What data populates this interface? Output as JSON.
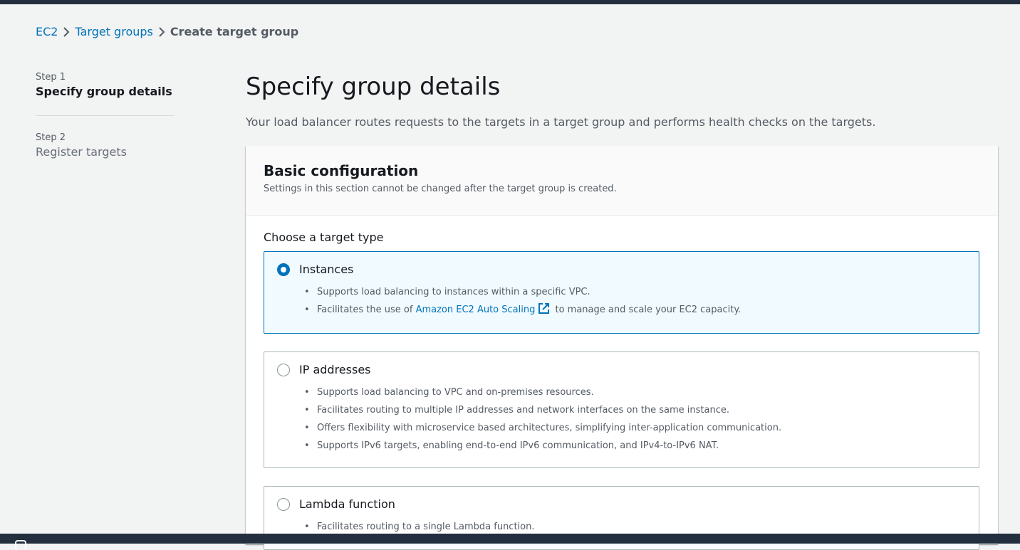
{
  "breadcrumb": {
    "items": [
      "EC2",
      "Target groups"
    ],
    "current": "Create target group"
  },
  "steps": [
    {
      "num": "Step 1",
      "title": "Specify group details"
    },
    {
      "num": "Step 2",
      "title": "Register targets"
    }
  ],
  "page": {
    "title": "Specify group details",
    "description": "Your load balancer routes requests to the targets in a target group and performs health checks on the targets."
  },
  "panel": {
    "title": "Basic configuration",
    "subtitle": "Settings in this section cannot be changed after the target group is created.",
    "field_label": "Choose a target type"
  },
  "target_types": [
    {
      "title": "Instances",
      "selected": true,
      "bullets": [
        "Supports load balancing to instances within a specific VPC."
      ],
      "link_bullet": {
        "prefix": "Facilitates the use of ",
        "link": "Amazon EC2 Auto Scaling",
        "suffix": " to manage and scale your EC2 capacity."
      }
    },
    {
      "title": "IP addresses",
      "selected": false,
      "bullets": [
        "Supports load balancing to VPC and on-premises resources.",
        "Facilitates routing to multiple IP addresses and network interfaces on the same instance.",
        "Offers flexibility with microservice based architectures, simplifying inter-application communication.",
        "Supports IPv6 targets, enabling end-to-end IPv6 communication, and IPv4-to-IPv6 NAT."
      ]
    },
    {
      "title": "Lambda function",
      "selected": false,
      "bullets": [
        "Facilitates routing to a single Lambda function."
      ]
    }
  ],
  "bullet_char": "•",
  "colors": {
    "link": "#0073bb",
    "selected_bg": "#f1faff",
    "nav_bar": "#232f3e"
  },
  "icons": [
    "chevron-right-icon",
    "external-link-icon",
    "cloudshell-icon"
  ]
}
